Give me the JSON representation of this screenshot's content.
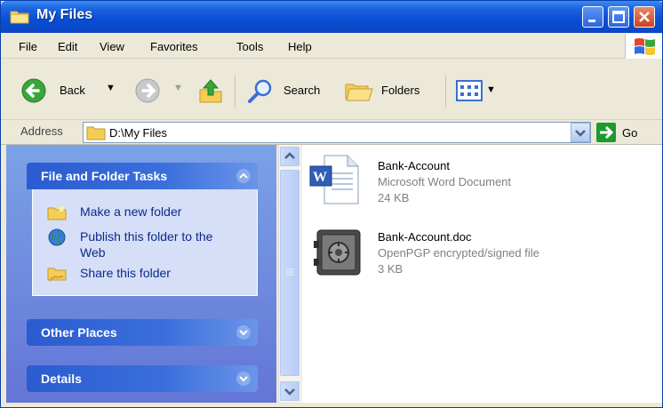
{
  "window": {
    "title": "My Files",
    "title_color": "#ffffff",
    "titlebar_color": "#0a4ed3"
  },
  "menu": {
    "items": [
      "File",
      "Edit",
      "View",
      "Favorites",
      "Tools",
      "Help"
    ]
  },
  "toolbar": {
    "back_label": "Back",
    "search_label": "Search",
    "folders_label": "Folders"
  },
  "address": {
    "label": "Address",
    "value": "D:\\My Files",
    "go_label": "Go"
  },
  "taskpane": {
    "file_folder_tasks": {
      "title": "File and Folder Tasks",
      "tasks": [
        {
          "label": "Make a new folder",
          "icon": "new-folder-icon"
        },
        {
          "label": "Publish this folder to the Web",
          "icon": "globe-icon"
        },
        {
          "label": "Share this folder",
          "icon": "share-folder-icon"
        }
      ]
    },
    "other_places": {
      "title": "Other Places"
    },
    "details": {
      "title": "Details"
    }
  },
  "files": [
    {
      "name": "Bank-Account",
      "type": "Microsoft Word Document",
      "size": "24 KB",
      "icon": "word-document-icon"
    },
    {
      "name": "Bank-Account.doc",
      "type": "OpenPGP encrypted/signed file",
      "size": "3 KB",
      "icon": "safe-icon"
    }
  ],
  "colors": {
    "taskpane_bg": "#6f8ddf",
    "panel_header": "#2b5bd0",
    "link_text": "#0b2a8a",
    "file_meta": "#808080"
  }
}
